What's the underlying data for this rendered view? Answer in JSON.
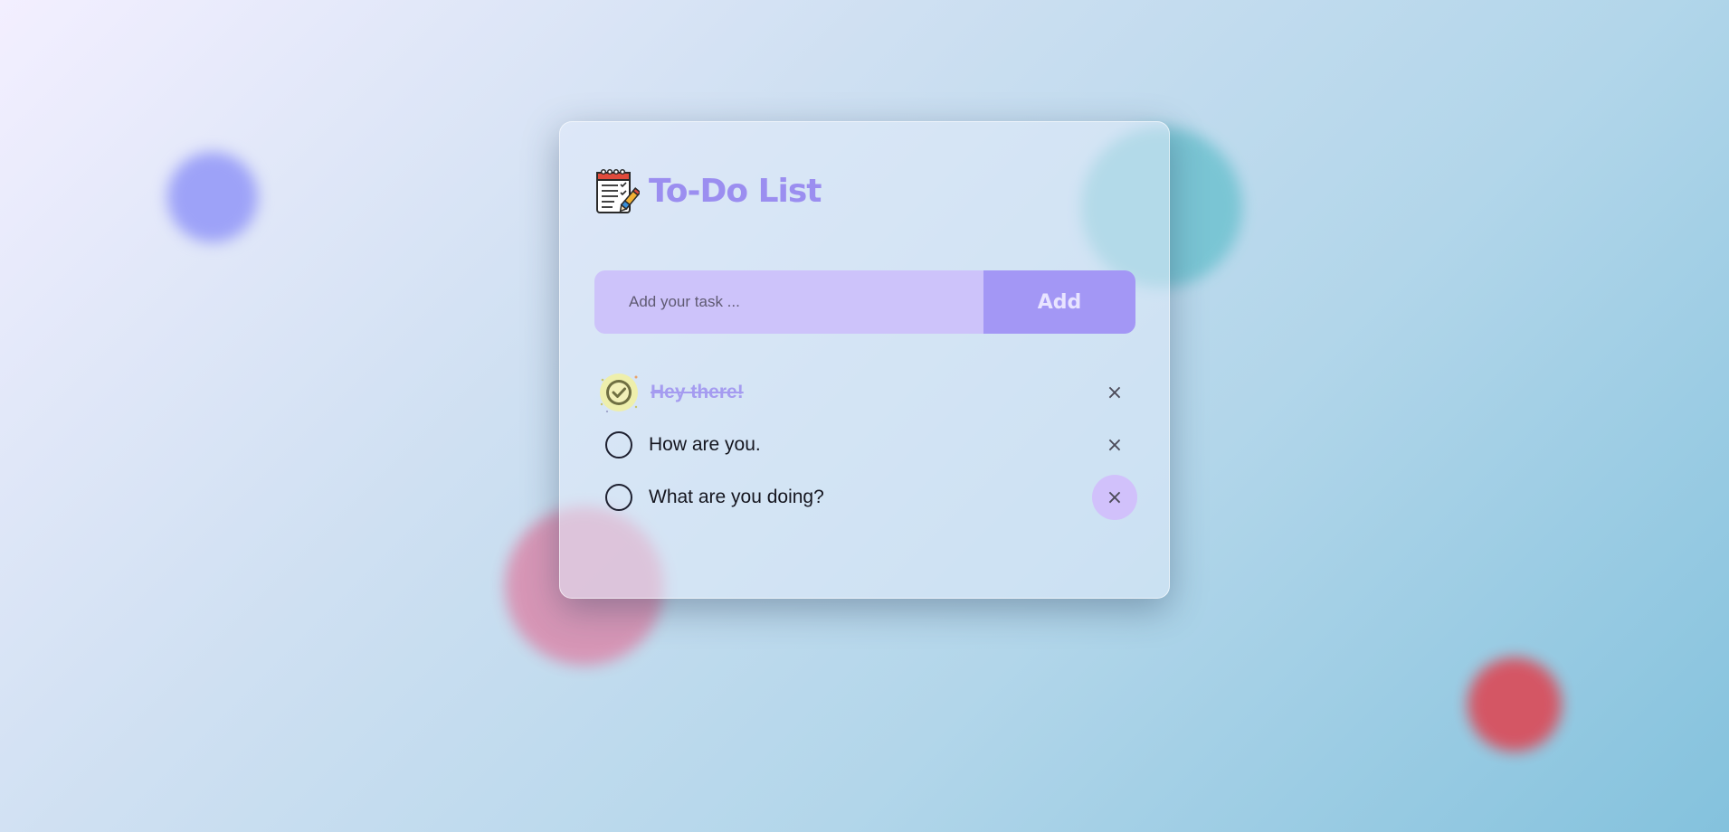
{
  "app": {
    "title": "To-Do List",
    "icon": "notepad-checklist-icon"
  },
  "input": {
    "placeholder": "Add your task ...",
    "value": ""
  },
  "add_button": {
    "label": "Add"
  },
  "tasks": [
    {
      "text": "Hey there!",
      "completed": true,
      "remove_label": "×"
    },
    {
      "text": "How are you.",
      "completed": false,
      "remove_label": "×"
    },
    {
      "text": "What are you doing?",
      "completed": false,
      "remove_label": "×"
    }
  ],
  "colors": {
    "accent": "#9b8ef0",
    "input_bg": "#cdc3fa",
    "button_bg": "#a397f5",
    "hover_bg": "#d1c1fb"
  }
}
